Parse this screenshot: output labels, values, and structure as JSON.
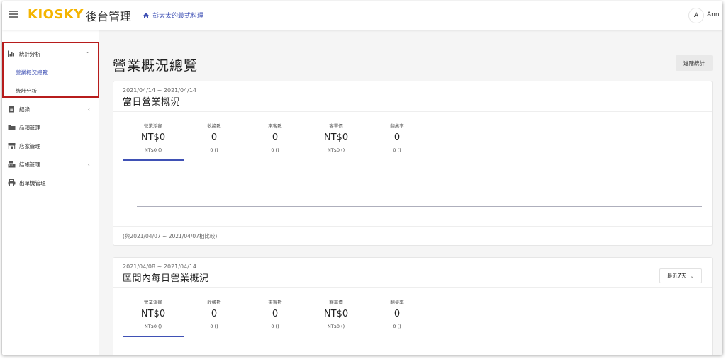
{
  "header": {
    "logo": "KIOSKY",
    "title": "後台管理",
    "store_name": "彭太太的義式料理",
    "avatar_initial": "A",
    "user_name": "Ann"
  },
  "sidebar": {
    "items": [
      {
        "label": "統計分析",
        "icon": "bar-chart-icon",
        "chevron": "⌄"
      },
      {
        "label": "營業概況總覽",
        "active": true
      },
      {
        "label": "統計分析"
      },
      {
        "label": "紀錄",
        "icon": "clipboard-icon",
        "chevron": "‹"
      },
      {
        "label": "品項管理",
        "icon": "folder-icon"
      },
      {
        "label": "店家管理",
        "icon": "store-icon"
      },
      {
        "label": "結帳管理",
        "icon": "cash-register-icon",
        "chevron": "‹"
      },
      {
        "label": "出單機管理",
        "icon": "printer-icon"
      }
    ],
    "highlight_color": "#b71c1c"
  },
  "main": {
    "page_title": "營業概況總覽",
    "advanced_button": "進階統計",
    "cards": [
      {
        "range": "2021/04/14 ~ 2021/04/14",
        "title": "當日營業概況",
        "metrics": [
          {
            "label": "營業淨額",
            "value": "NT$0",
            "sub": "NT$0 ()"
          },
          {
            "label": "收據數",
            "value": "0",
            "sub": "0 ()"
          },
          {
            "label": "來客數",
            "value": "0",
            "sub": "0 ()"
          },
          {
            "label": "客單價",
            "value": "NT$0",
            "sub": "NT$0 ()"
          },
          {
            "label": "翻桌率",
            "value": "0",
            "sub": "0 ()"
          }
        ],
        "compare_note": "(與2021/04/07 ~ 2021/04/07相比較)"
      },
      {
        "range": "2021/04/08 ~ 2021/04/14",
        "title": "區間內每日營業概況",
        "period_select": "最近7天",
        "metrics": [
          {
            "label": "營業淨額",
            "value": "NT$0",
            "sub": "NT$0 ()"
          },
          {
            "label": "收據數",
            "value": "0",
            "sub": "0 ()"
          },
          {
            "label": "來客數",
            "value": "0",
            "sub": "0 ()"
          },
          {
            "label": "客單價",
            "value": "NT$0",
            "sub": "NT$0 ()"
          },
          {
            "label": "翻桌率",
            "value": "0",
            "sub": "0 ()"
          }
        ]
      }
    ]
  },
  "colors": {
    "brand": "#f4b400",
    "accent": "#3f51b5"
  }
}
